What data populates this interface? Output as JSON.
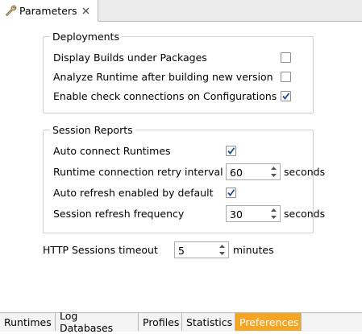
{
  "tab": {
    "title": "Parameters",
    "icon": "wrench-icon"
  },
  "deployments": {
    "title": "Deployments",
    "items": [
      {
        "label": "Display Builds under Packages",
        "checked": false
      },
      {
        "label": "Analyze Runtime after building new version",
        "checked": false
      },
      {
        "label": "Enable check connections on Configurations",
        "checked": true
      }
    ]
  },
  "session_reports": {
    "title": "Session Reports",
    "auto_connect": {
      "label": "Auto connect Runtimes",
      "checked": true
    },
    "retry_interval": {
      "label": "Runtime connection retry interval",
      "value": "60",
      "unit": "seconds"
    },
    "auto_refresh": {
      "label": "Auto refresh enabled by default",
      "checked": true
    },
    "refresh_frequency": {
      "label": "Session refresh frequency",
      "value": "30",
      "unit": "seconds"
    }
  },
  "http_timeout": {
    "label": "HTTP Sessions timeout",
    "value": "5",
    "unit": "minutes"
  },
  "bottom_tabs": [
    "Runtimes",
    "Log Databases",
    "Profiles",
    "Statistics",
    "Preferences"
  ],
  "active_bottom_tab": "Preferences",
  "colors": {
    "active_tab": "#f4a523",
    "check": "#1f4e8c",
    "border": "#cfcfcf"
  }
}
